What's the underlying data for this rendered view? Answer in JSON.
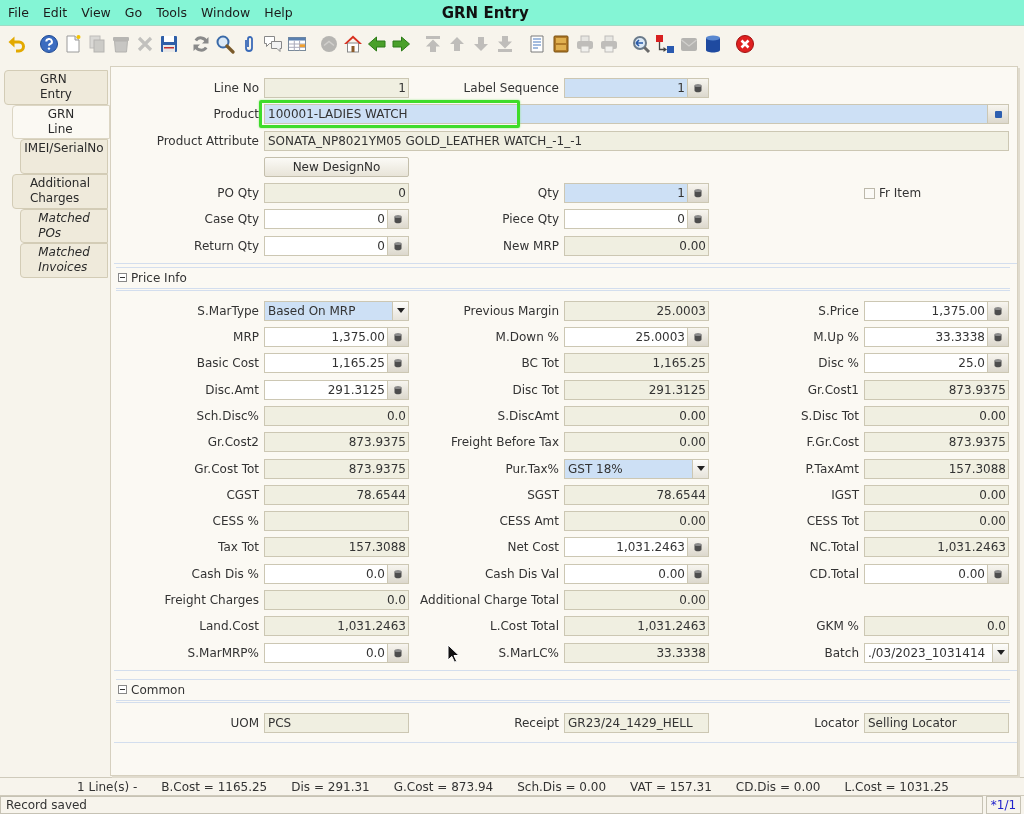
{
  "window": {
    "title": "GRN Entry"
  },
  "menu": [
    {
      "label": "File"
    },
    {
      "label": "Edit"
    },
    {
      "label": "View"
    },
    {
      "label": "Go"
    },
    {
      "label": "Tools"
    },
    {
      "label": "Window"
    },
    {
      "label": "Help"
    }
  ],
  "toolbar": [
    {
      "items": [
        {
          "kind": "undo",
          "disabled": false
        }
      ]
    },
    {
      "items": [
        {
          "kind": "help",
          "disabled": false
        },
        {
          "kind": "new",
          "disabled": false
        },
        {
          "kind": "copy",
          "disabled": true
        },
        {
          "kind": "delete",
          "disabled": true
        },
        {
          "kind": "clear",
          "disabled": true
        },
        {
          "kind": "save",
          "disabled": false
        }
      ]
    },
    {
      "items": [
        {
          "kind": "refresh",
          "disabled": false
        },
        {
          "kind": "find",
          "disabled": false
        },
        {
          "kind": "attach",
          "disabled": false
        },
        {
          "kind": "chat",
          "disabled": false
        },
        {
          "kind": "grid",
          "disabled": false
        }
      ]
    },
    {
      "items": [
        {
          "kind": "history",
          "disabled": true
        },
        {
          "kind": "home",
          "disabled": false
        },
        {
          "kind": "parent",
          "disabled": false
        },
        {
          "kind": "detail",
          "disabled": false
        }
      ]
    },
    {
      "items": [
        {
          "kind": "first",
          "disabled": true
        },
        {
          "kind": "previous",
          "disabled": true
        },
        {
          "kind": "next",
          "disabled": true
        },
        {
          "kind": "last",
          "disabled": true
        }
      ]
    },
    {
      "items": [
        {
          "kind": "report",
          "disabled": false
        },
        {
          "kind": "archive",
          "disabled": false
        },
        {
          "kind": "preview",
          "disabled": true
        },
        {
          "kind": "print",
          "disabled": true
        }
      ]
    },
    {
      "items": [
        {
          "kind": "zoom",
          "disabled": false
        },
        {
          "kind": "workflow",
          "disabled": false
        },
        {
          "kind": "request",
          "disabled": true
        },
        {
          "kind": "info",
          "disabled": false
        }
      ]
    },
    {
      "items": [
        {
          "kind": "exit",
          "disabled": false
        }
      ]
    }
  ],
  "tabs": [
    {
      "label": "GRN Entry",
      "selected": false,
      "read_only": false,
      "children": [
        {
          "label": "GRN Line",
          "selected": true,
          "read_only": false,
          "children": [
            {
              "label": "IMEI/SerialNo",
              "selected": false,
              "read_only": false
            }
          ]
        },
        {
          "label": "Additional Charges",
          "selected": false,
          "read_only": false,
          "children": [
            {
              "label": "Matched POs",
              "selected": false,
              "read_only": true
            },
            {
              "label": "Matched Invoices",
              "selected": false,
              "read_only": true
            }
          ]
        }
      ]
    }
  ],
  "form": {
    "rows": [
      [
        {
          "label": "Line No",
          "kind": "number",
          "value": "1",
          "read_only": true,
          "calculator": false
        },
        {
          "label": "Label Sequence",
          "kind": "number",
          "value": "1",
          "read_only": false,
          "mandatory": true,
          "calculator": true
        }
      ],
      [
        {
          "label": "Product",
          "kind": "search",
          "value": "100001-LADIES WATCH",
          "read_only": false,
          "mandatory": true,
          "calculator": false,
          "highlighted": true
        }
      ],
      [
        {
          "label": "Product Attribute",
          "kind": "text",
          "value": "SONATA_NP8021YM05 GOLD_LEATHER WATCH_-1_-1",
          "read_only": true,
          "calculator": false
        }
      ],
      [
        {
          "label": "New DesignNo",
          "kind": "button"
        }
      ],
      [
        {
          "label": "PO Qty",
          "kind": "number",
          "value": "0",
          "read_only": true,
          "calculator": false
        },
        {
          "label": "Qty",
          "kind": "number",
          "value": "1",
          "read_only": false,
          "mandatory": true,
          "calculator": true
        },
        {
          "label": "Fr Item",
          "kind": "checkbox",
          "checked": false
        }
      ],
      [
        {
          "label": "Case Qty",
          "kind": "number",
          "value": "0",
          "read_only": false,
          "mandatory": false,
          "calculator": true
        },
        {
          "label": "Piece Qty",
          "kind": "number",
          "value": "0",
          "read_only": false,
          "mandatory": false,
          "calculator": true
        }
      ],
      [
        {
          "label": "Return Qty",
          "kind": "number",
          "value": "0",
          "read_only": false,
          "mandatory": false,
          "calculator": true
        },
        {
          "label": "New MRP",
          "kind": "number",
          "value": "0.00",
          "read_only": true,
          "calculator": false
        }
      ]
    ],
    "sections": [
      {
        "title": "Price Info",
        "expanded": true,
        "rows": [
          [
            {
              "label": "S.MarType",
              "kind": "select",
              "value": "Based On MRP",
              "read_only": false,
              "mandatory": true,
              "calculator": false
            },
            {
              "label": "Previous Margin",
              "kind": "number",
              "value": "25.0003",
              "read_only": true,
              "calculator": false
            },
            {
              "label": "S.Price",
              "kind": "number",
              "value": "1,375.00",
              "read_only": false,
              "mandatory": false,
              "calculator": true
            }
          ],
          [
            {
              "label": "MRP",
              "kind": "number",
              "value": "1,375.00",
              "read_only": false,
              "mandatory": false,
              "calculator": true
            },
            {
              "label": "M.Down %",
              "kind": "number",
              "value": "25.0003",
              "read_only": false,
              "mandatory": false,
              "calculator": true
            },
            {
              "label": "M.Up %",
              "kind": "number",
              "value": "33.3338",
              "read_only": false,
              "mandatory": false,
              "calculator": true
            }
          ],
          [
            {
              "label": "Basic Cost",
              "kind": "number",
              "value": "1,165.25",
              "read_only": false,
              "mandatory": false,
              "calculator": true
            },
            {
              "label": "BC Tot",
              "kind": "number",
              "value": "1,165.25",
              "read_only": true,
              "calculator": false
            },
            {
              "label": "Disc %",
              "kind": "number",
              "value": "25.0",
              "read_only": false,
              "mandatory": false,
              "calculator": true
            }
          ],
          [
            {
              "label": "Disc.Amt",
              "kind": "number",
              "value": "291.3125",
              "read_only": false,
              "mandatory": false,
              "calculator": true
            },
            {
              "label": "Disc Tot",
              "kind": "number",
              "value": "291.3125",
              "read_only": true,
              "calculator": false
            },
            {
              "label": "Gr.Cost1",
              "kind": "number",
              "value": "873.9375",
              "read_only": true,
              "calculator": false
            }
          ],
          [
            {
              "label": "Sch.Disc%",
              "kind": "number",
              "value": "0.0",
              "read_only": true,
              "calculator": false
            },
            {
              "label": "S.DiscAmt",
              "kind": "number",
              "value": "0.00",
              "read_only": true,
              "calculator": false
            },
            {
              "label": "S.Disc Tot",
              "kind": "number",
              "value": "0.00",
              "read_only": true,
              "calculator": false
            }
          ],
          [
            {
              "label": "Gr.Cost2",
              "kind": "number",
              "value": "873.9375",
              "read_only": true,
              "calculator": false
            },
            {
              "label": "Freight Before Tax",
              "kind": "number",
              "value": "0.00",
              "read_only": true,
              "calculator": false
            },
            {
              "label": "F.Gr.Cost",
              "kind": "number",
              "value": "873.9375",
              "read_only": true,
              "calculator": false
            }
          ],
          [
            {
              "label": "Gr.Cost Tot",
              "kind": "number",
              "value": "873.9375",
              "read_only": true,
              "calculator": false
            },
            {
              "label": "Pur.Tax%",
              "kind": "select",
              "value": "GST 18%",
              "read_only": false,
              "mandatory": true,
              "calculator": false
            },
            {
              "label": "P.TaxAmt",
              "kind": "number",
              "value": "157.3088",
              "read_only": true,
              "calculator": false
            }
          ],
          [
            {
              "label": "CGST",
              "kind": "number",
              "value": "78.6544",
              "read_only": true,
              "calculator": false
            },
            {
              "label": "SGST",
              "kind": "number",
              "value": "78.6544",
              "read_only": true,
              "calculator": false
            },
            {
              "label": "IGST",
              "kind": "number",
              "value": "0.00",
              "read_only": true,
              "calculator": false
            }
          ],
          [
            {
              "label": "CESS %",
              "kind": "number",
              "read_only": true,
              "calculator": false
            },
            {
              "label": "CESS Amt",
              "kind": "number",
              "value": "0.00",
              "read_only": true,
              "calculator": false
            },
            {
              "label": "CESS Tot",
              "kind": "number",
              "value": "0.00",
              "read_only": true,
              "calculator": false
            }
          ],
          [
            {
              "label": "Tax Tot",
              "kind": "number",
              "value": "157.3088",
              "read_only": true,
              "calculator": false
            },
            {
              "label": "Net Cost",
              "kind": "number",
              "value": "1,031.2463",
              "read_only": false,
              "mandatory": false,
              "calculator": true
            },
            {
              "label": "NC.Total",
              "kind": "number",
              "value": "1,031.2463",
              "read_only": true,
              "calculator": false
            }
          ],
          [
            {
              "label": "Cash Dis %",
              "kind": "number",
              "value": "0.0",
              "read_only": false,
              "mandatory": false,
              "calculator": true
            },
            {
              "label": "Cash Dis Val",
              "kind": "number",
              "value": "0.00",
              "read_only": false,
              "mandatory": false,
              "calculator": true
            },
            {
              "label": "CD.Total",
              "kind": "number",
              "value": "0.00",
              "read_only": false,
              "mandatory": false,
              "calculator": true
            }
          ],
          [
            {
              "label": "Freight Charges",
              "kind": "number",
              "value": "0.0",
              "read_only": true,
              "calculator": false
            },
            {
              "label": "Additional Charge Total",
              "kind": "number",
              "value": "0.00",
              "read_only": true,
              "calculator": false
            }
          ],
          [
            {
              "label": "Land.Cost",
              "kind": "number",
              "value": "1,031.2463",
              "read_only": true,
              "calculator": false
            },
            {
              "label": "L.Cost Total",
              "kind": "number",
              "value": "1,031.2463",
              "read_only": true,
              "calculator": false
            },
            {
              "label": "GKM %",
              "kind": "number",
              "value": "0.0",
              "read_only": true,
              "calculator": false
            }
          ],
          [
            {
              "label": "S.MarMRP%",
              "kind": "number",
              "value": "0.0",
              "read_only": false,
              "mandatory": false,
              "calculator": true
            },
            {
              "label": "S.MarLC%",
              "kind": "number",
              "value": "33.3338",
              "read_only": true,
              "calculator": false
            },
            {
              "label": "Batch",
              "kind": "select",
              "value": "./03/2023_1031414",
              "read_only": false,
              "mandatory": false,
              "calculator": false
            }
          ]
        ]
      },
      {
        "title": "Common",
        "expanded": true,
        "rows": [
          [
            {
              "label": "UOM",
              "kind": "text",
              "value": "PCS",
              "read_only": true,
              "calculator": false
            },
            {
              "label": "Receipt",
              "kind": "text",
              "value": "GR23/24_1429_HELL",
              "read_only": true,
              "calculator": false
            },
            {
              "label": "Locator",
              "kind": "text",
              "value": "Selling Locator",
              "read_only": true,
              "calculator": false
            }
          ]
        ]
      }
    ]
  },
  "summary_bar": [
    "1 Line(s) -",
    "B.Cost = 1165.25",
    "Dis = 291.31",
    "G.Cost = 873.94",
    "Sch.Dis = 0.00",
    "VAT = 157.31",
    "CD.Dis = 0.00",
    "L.Cost = 1031.25"
  ],
  "status_bar": {
    "message": "Record saved",
    "record": "*1/1"
  }
}
